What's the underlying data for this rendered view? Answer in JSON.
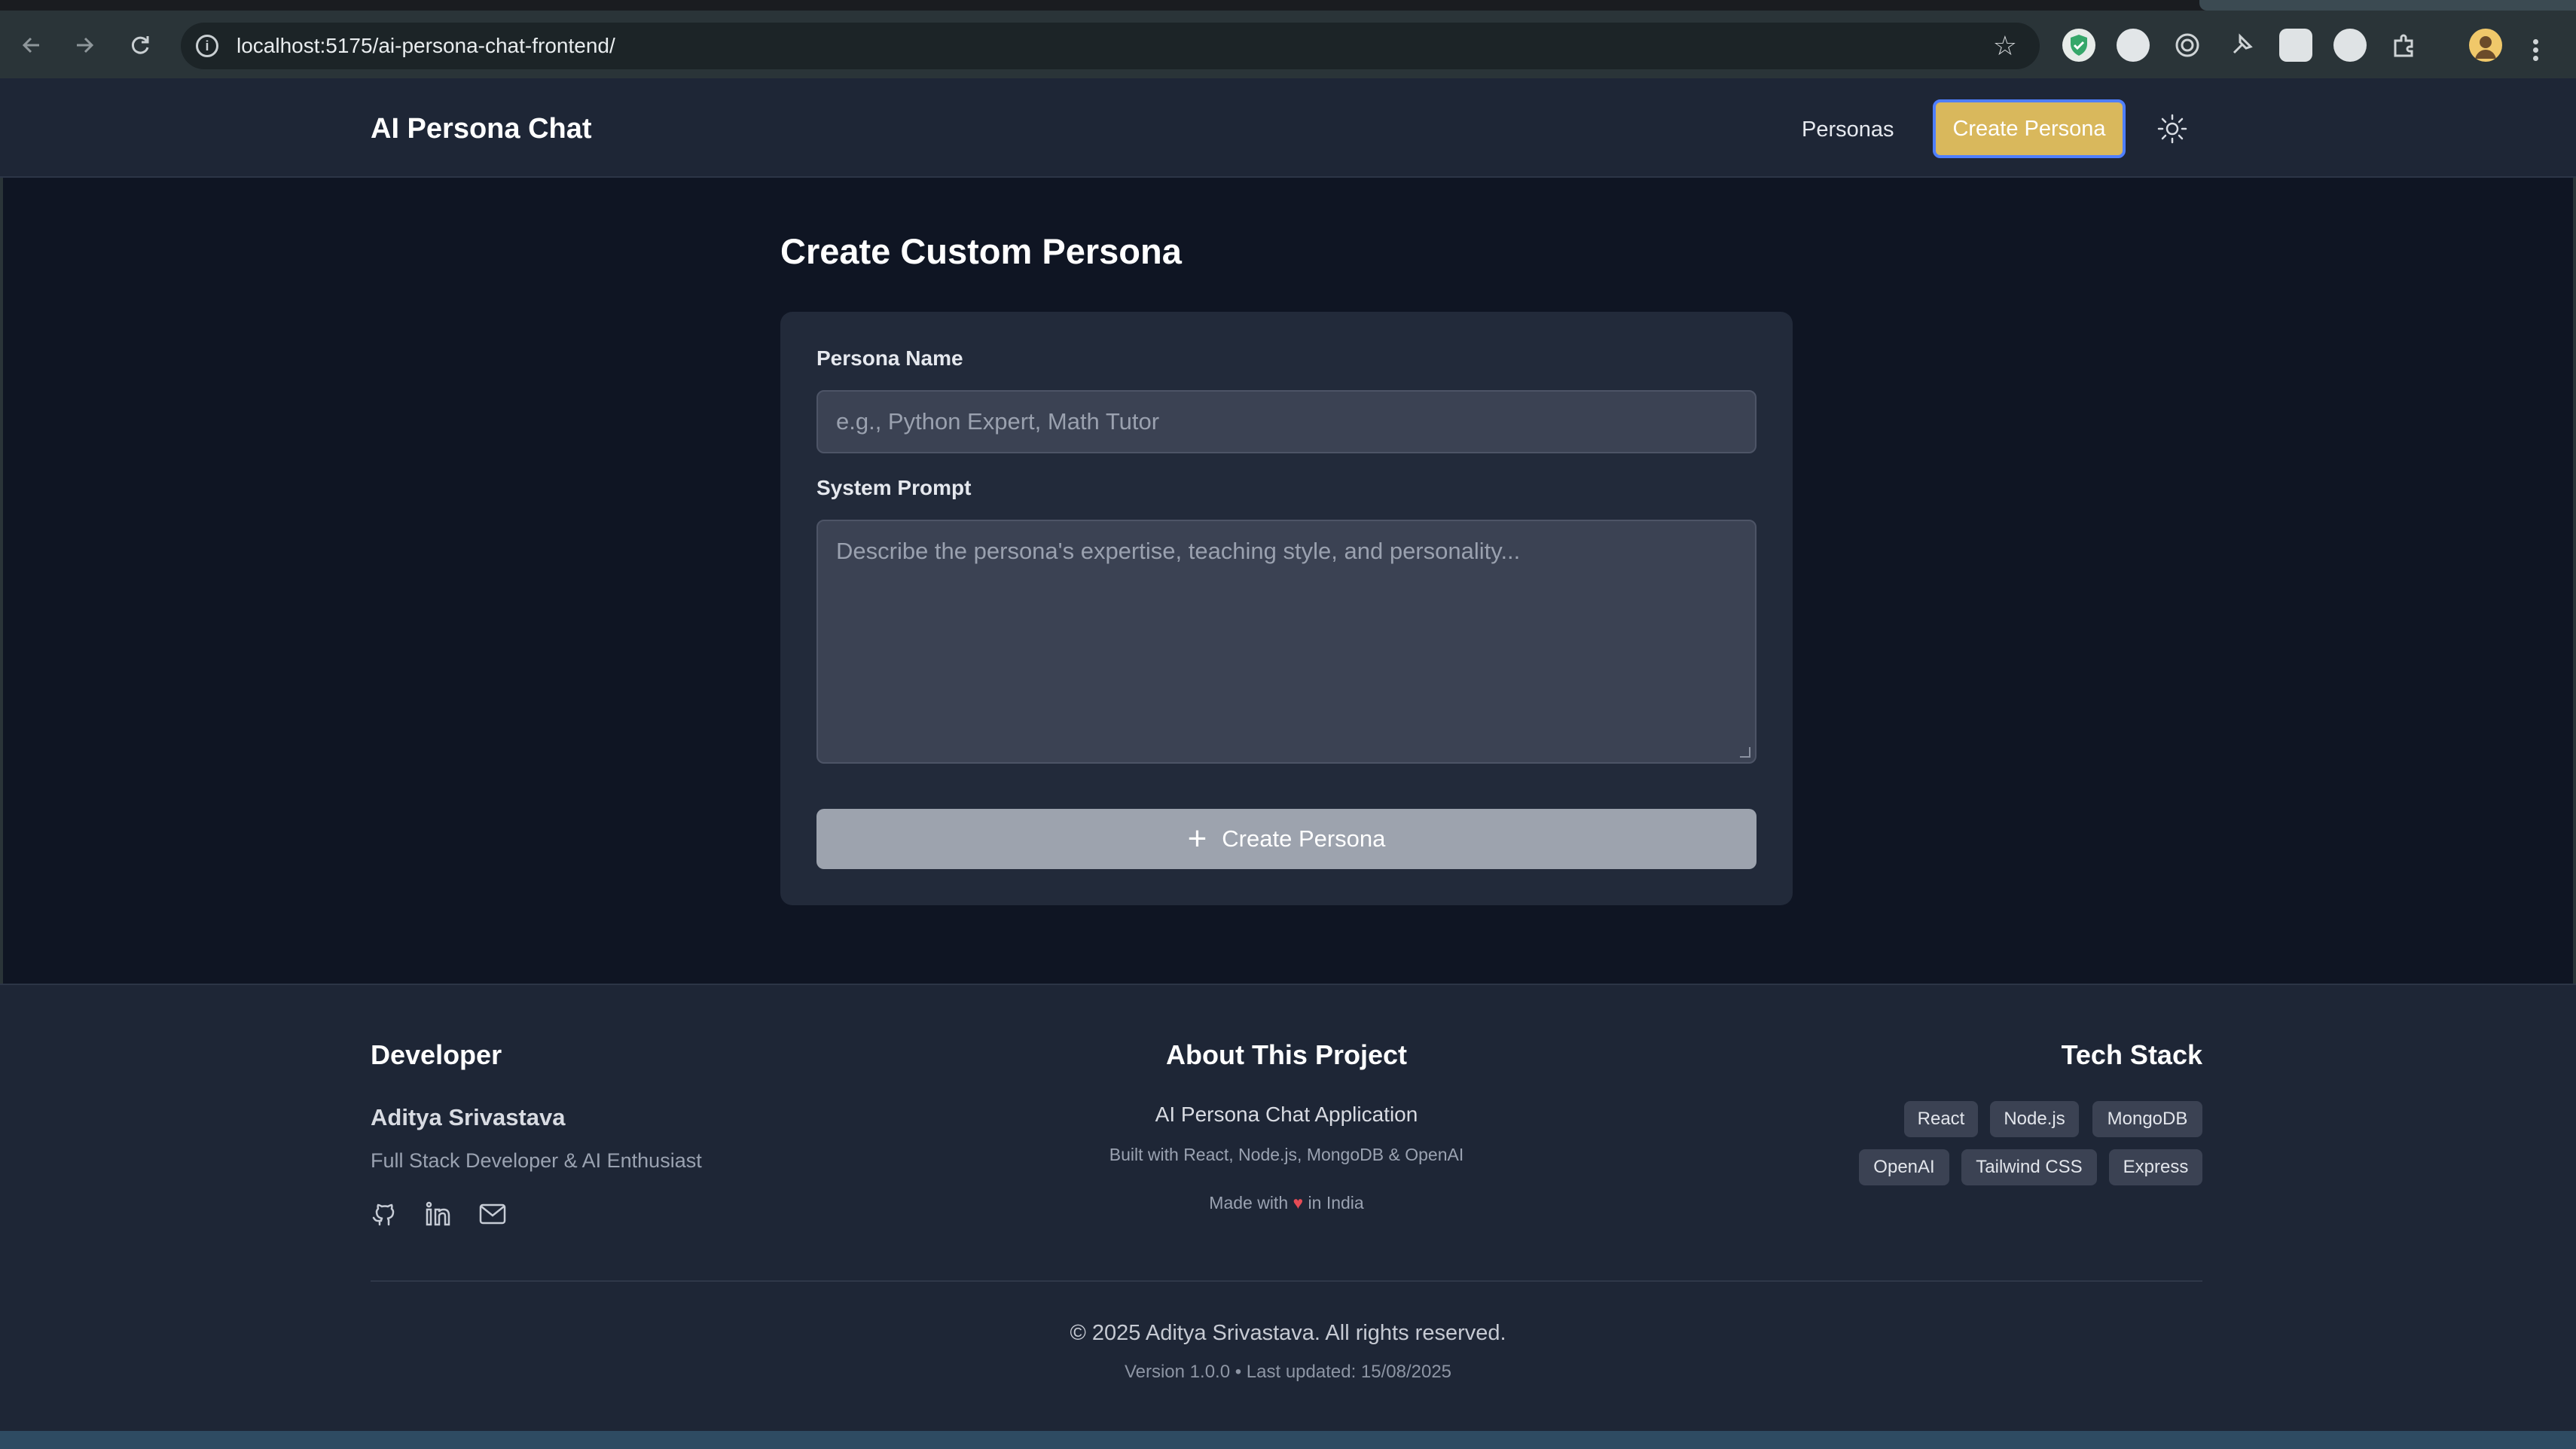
{
  "browser": {
    "url": "localhost:5175/ai-persona-chat-frontend/",
    "back_icon": "arrow-left-icon",
    "forward_icon": "arrow-right-icon",
    "reload_icon": "reload-icon"
  },
  "header": {
    "brand": "AI Persona Chat",
    "nav_personas": "Personas",
    "nav_create": "Create Persona",
    "theme_icon": "sun-icon"
  },
  "main": {
    "title": "Create Custom Persona",
    "form": {
      "name_label": "Persona Name",
      "name_placeholder": "e.g., Python Expert, Math Tutor",
      "name_value": "",
      "prompt_label": "System Prompt",
      "prompt_placeholder": "Describe the persona's expertise, teaching style, and personality...",
      "prompt_value": "",
      "submit_label": "Create Persona",
      "submit_icon": "+"
    }
  },
  "footer": {
    "developer": {
      "heading": "Developer",
      "name": "Aditya Srivastava",
      "role": "Full Stack Developer & AI Enthusiast",
      "links": [
        "github-icon",
        "linkedin-icon",
        "mail-icon"
      ]
    },
    "about": {
      "heading": "About This Project",
      "title": "AI Persona Chat Application",
      "subtitle": "Built with React, Node.js, MongoDB & OpenAI",
      "made_prefix": "Made with",
      "made_suffix": "in India",
      "heart": "♥"
    },
    "tech": {
      "heading": "Tech Stack",
      "tags": [
        "React",
        "Node.js",
        "MongoDB",
        "OpenAI",
        "Tailwind CSS",
        "Express"
      ]
    },
    "copyright": "© 2025 Aditya Srivastava. All rights reserved.",
    "version": "Version 1.0.0 • Last updated: 15/08/2025"
  },
  "colors": {
    "accent": "#d9b85c",
    "focus_ring": "#4f7fff",
    "background": "#0f1523",
    "surface": "#1e2636"
  }
}
